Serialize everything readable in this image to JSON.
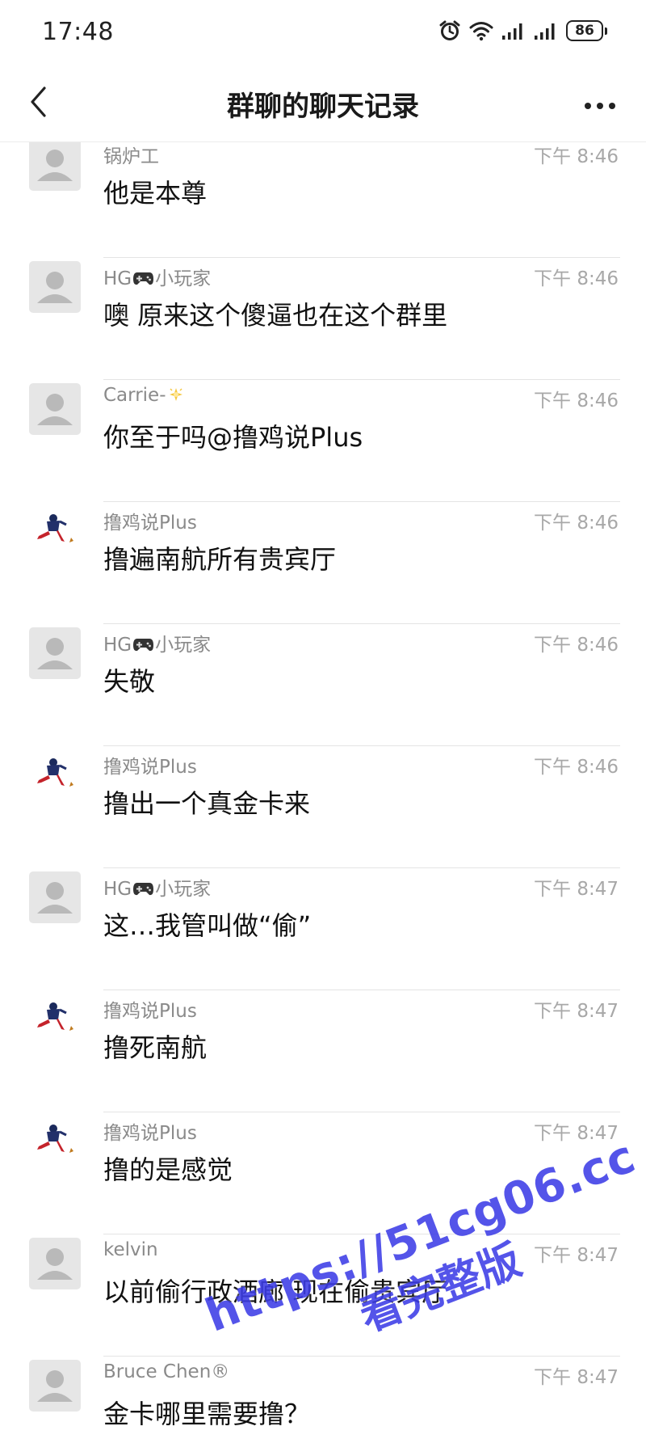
{
  "status_bar": {
    "time": "17:48",
    "battery_level": "86",
    "icons": [
      "alarm-icon",
      "wifi-icon",
      "signal-icon",
      "signal-icon",
      "battery-icon"
    ]
  },
  "header": {
    "title": "群聊的聊天记录",
    "back_icon": "chevron-left-icon",
    "more_icon": "more-dots-icon"
  },
  "messages": [
    {
      "sender": "锅炉工",
      "time": "下午 8:46",
      "text": "他是本尊",
      "avatar": "default"
    },
    {
      "sender_prefix": "HG",
      "sender_suffix": "小玩家",
      "sender_emoji": "gamepad-icon",
      "time": "下午 8:46",
      "text": "噢 原来这个傻逼也在这个群里",
      "avatar": "default"
    },
    {
      "sender_prefix": "Carrie-",
      "sender_emoji": "sparkle-icon",
      "time": "下午 8:46",
      "text": "你至于吗@撸鸡说Plus",
      "avatar": "default"
    },
    {
      "sender": "撸鸡说Plus",
      "time": "下午 8:46",
      "text": "撸遍南航所有贵宾厅",
      "avatar": "custom"
    },
    {
      "sender_prefix": "HG",
      "sender_suffix": "小玩家",
      "sender_emoji": "gamepad-icon",
      "time": "下午 8:46",
      "text": "失敬",
      "avatar": "default"
    },
    {
      "sender": "撸鸡说Plus",
      "time": "下午 8:46",
      "text": "撸出一个真金卡来",
      "avatar": "custom"
    },
    {
      "sender_prefix": "HG",
      "sender_suffix": "小玩家",
      "sender_emoji": "gamepad-icon",
      "time": "下午 8:47",
      "text": "这…我管叫做“偷”",
      "avatar": "default"
    },
    {
      "sender": "撸鸡说Plus",
      "time": "下午 8:47",
      "text": "撸死南航",
      "avatar": "custom"
    },
    {
      "sender": "撸鸡说Plus",
      "time": "下午 8:47",
      "text": "撸的是感觉",
      "avatar": "custom"
    },
    {
      "sender": "kelvin",
      "time": "下午 8:47",
      "text": "以前偷行政酒廊 现在偷贵宾厅",
      "avatar": "default"
    },
    {
      "sender": "Bruce Chen®",
      "time": "下午 8:47",
      "text": "金卡哪里需要撸？",
      "avatar": "default"
    }
  ],
  "watermark": {
    "url": "https://51cg06.cc",
    "subtitle": "看完整版",
    "color": "#3d3de6"
  }
}
